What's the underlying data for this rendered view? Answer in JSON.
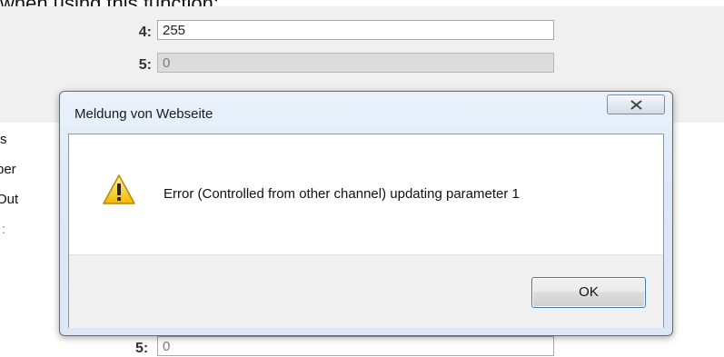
{
  "background": {
    "top_text": "when using this function:",
    "params": [
      {
        "label": "4:",
        "value": "255",
        "disabled": false
      },
      {
        "label": "5:",
        "value": "0",
        "disabled": true
      }
    ],
    "side_labels": [
      "s",
      "per",
      "Out",
      ":"
    ],
    "bottom_param": {
      "label": "5:",
      "value": "0"
    }
  },
  "dialog": {
    "title": "Meldung von Webseite",
    "close_icon": "close-x-icon",
    "icon": "warning-triangle-icon",
    "message": "Error (Controlled from other channel) updating parameter 1",
    "ok_label": "OK"
  },
  "colors": {
    "dialog_frame": "#dce9f6",
    "ok_border": "#3c7fb1",
    "warning_yellow": "#f5c400"
  }
}
